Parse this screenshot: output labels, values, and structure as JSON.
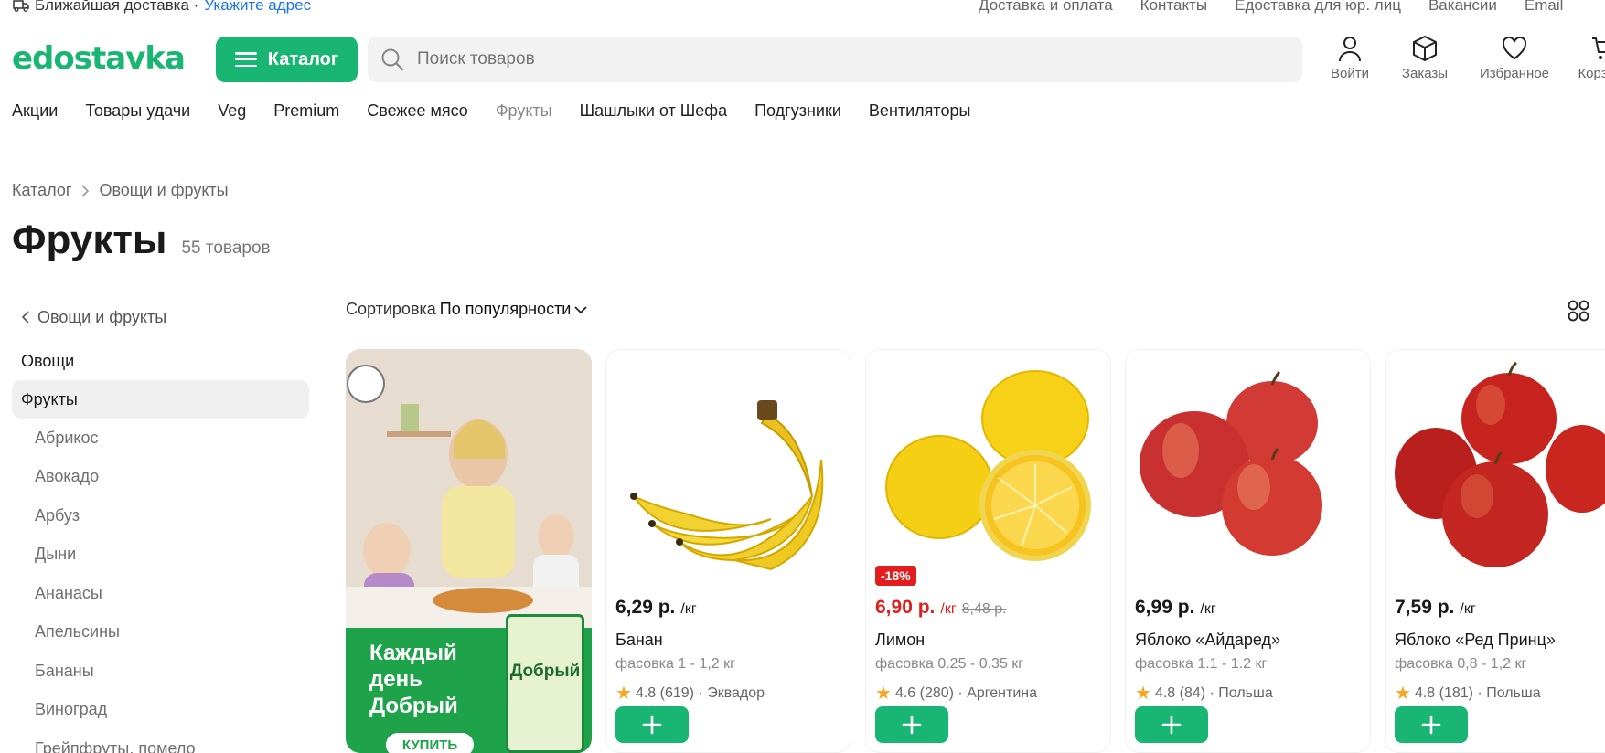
{
  "top_strip": {
    "delivery_label": "Ближайшая доставка ·",
    "address_link": "Укажите адрес",
    "links": [
      "Доставка и оплата",
      "Контакты",
      "Едоставка для юр. лиц",
      "Вакансии",
      "Email"
    ]
  },
  "header": {
    "logo": "edostavka",
    "catalog_button": "Каталог",
    "search_placeholder": "Поиск товаров",
    "icons": [
      {
        "label": "Войти",
        "icon": "user-icon"
      },
      {
        "label": "Заказы",
        "icon": "box-icon"
      },
      {
        "label": "Избранное",
        "icon": "heart-icon"
      },
      {
        "label": "Корзина",
        "icon": "cart-icon"
      }
    ]
  },
  "promo_nav": [
    "Акции",
    "Товары удачи",
    "Veg",
    "Premium",
    "Свежее мясо",
    "Фрукты",
    "Шашлыки от Шефа",
    "Подгузники",
    "Вентиляторы"
  ],
  "breadcrumb": {
    "root": "Каталог",
    "current": "Овощи и фрукты"
  },
  "page": {
    "title": "Фрукты",
    "count": "55 товаров"
  },
  "sidebar": {
    "back": "Овощи и фрукты",
    "categories": [
      "Овощи",
      "Фрукты"
    ],
    "subcategories": [
      "Абрикос",
      "Авокадо",
      "Арбуз",
      "Дыни",
      "Ананасы",
      "Апельсины",
      "Бананы",
      "Виноград",
      "Грейпфруты, помело"
    ]
  },
  "sort": {
    "label": "Сортировка",
    "value": "По популярности"
  },
  "banner": {
    "slogan": "Каждый день Добрый",
    "button": "КУПИТЬ",
    "pack_label": "Добрый"
  },
  "products": [
    {
      "price": "6,29 р.",
      "unit": "/кг",
      "name": "Банан",
      "pack": "фасовка 1 - 1,2 кг",
      "rating": "4.8 (619) · Эквадор",
      "image": "banana"
    },
    {
      "price": "6,90 р.",
      "unit": "/кг",
      "old_price": "8,48 р.",
      "badge": "-18%",
      "name": "Лимон",
      "pack": "фасовка 0.25 - 0.35 кг",
      "rating": "4.6 (280) · Аргентина",
      "image": "lemon"
    },
    {
      "price": "6,99 р.",
      "unit": "/кг",
      "name": "Яблоко «Айдаред»",
      "pack": "фасовка 1.1 - 1.2 кг",
      "rating": "4.8 (84) · Польша",
      "image": "apple-idared"
    },
    {
      "price": "7,59 р.",
      "unit": "/кг",
      "name": "Яблоко «Ред Принц»",
      "pack": "фасовка 0,8 - 1,2 кг",
      "rating": "4.8 (181) · Польша",
      "image": "apple-red-prince"
    }
  ],
  "colors": {
    "brand": "#19b572",
    "sale": "#e11d1d",
    "link": "#1a73e8"
  }
}
